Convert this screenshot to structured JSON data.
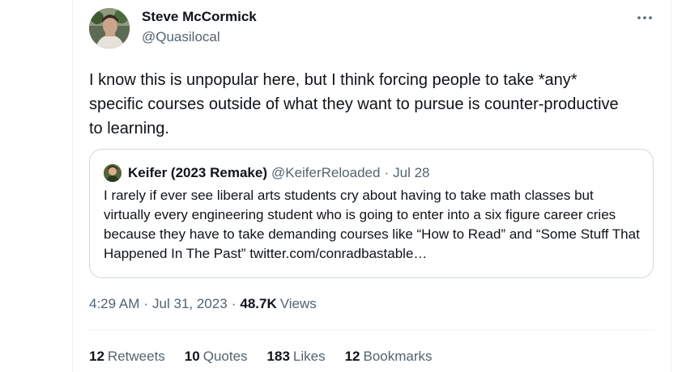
{
  "tweet": {
    "author": {
      "name": "Steve McCormick",
      "handle": "@Quasilocal"
    },
    "text": "I know this is unpopular here, but I think forcing people to take *any* specific courses outside of what they want to pursue is counter-productive to learning.",
    "more_icon": "more-horizontal-icon"
  },
  "quote": {
    "name": "Keifer (2023 Remake)",
    "handle": "@KeiferReloaded",
    "date": "Jul 28",
    "text": "I rarely if ever see liberal arts students cry about having to take math classes but virtually every engineering student who is going to enter into a six figure career cries because they have to take demanding courses like “How to Read” and “Some Stuff That Happened In The Past” twitter.com/conradbastable…"
  },
  "meta": {
    "time": "4:29 AM",
    "date": "Jul 31, 2023",
    "views_count": "48.7K",
    "views_label": "Views"
  },
  "stats": [
    {
      "count": "12",
      "label": "Retweets"
    },
    {
      "count": "10",
      "label": "Quotes"
    },
    {
      "count": "183",
      "label": "Likes"
    },
    {
      "count": "12",
      "label": "Bookmarks"
    }
  ],
  "colors": {
    "primary_text": "#0f1419",
    "secondary_text": "#536471",
    "border": "#cfd9de",
    "divider": "#eff3f4"
  }
}
